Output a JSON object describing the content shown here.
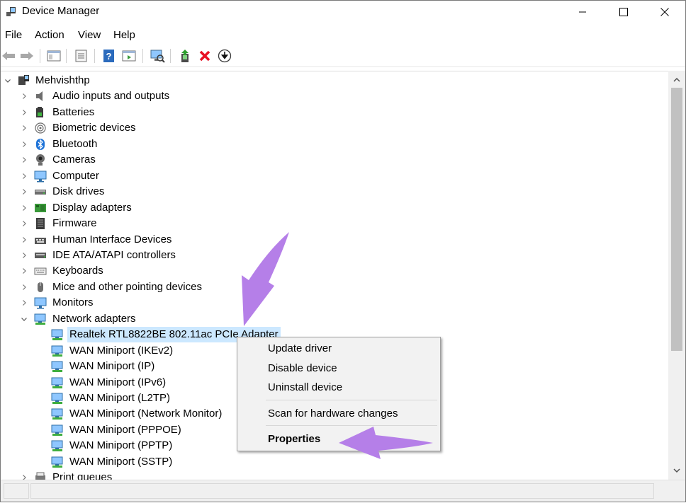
{
  "window": {
    "title": "Device Manager",
    "controls": {
      "minimize": "minimize",
      "maximize": "maximize",
      "close": "close"
    }
  },
  "menu": [
    "File",
    "Action",
    "View",
    "Help"
  ],
  "toolbar": {
    "buttons": [
      "back-icon",
      "forward-icon",
      "console-tree-icon",
      "properties-icon",
      "help-icon",
      "action-pane-icon",
      "scan-hardware-icon",
      "update-driver-icon",
      "uninstall-icon",
      "download-icon"
    ],
    "accent_red": "#e81123"
  },
  "tree": {
    "root": "Mehvishthp",
    "categories": [
      "Audio inputs and outputs",
      "Batteries",
      "Biometric devices",
      "Bluetooth",
      "Cameras",
      "Computer",
      "Disk drives",
      "Display adapters",
      "Firmware",
      "Human Interface Devices",
      "IDE ATA/ATAPI controllers",
      "Keyboards",
      "Mice and other pointing devices",
      "Monitors",
      "Network adapters"
    ],
    "network_adapters": [
      "Realtek RTL8822BE 802.11ac PCIe Adapter",
      "WAN Miniport (IKEv2)",
      "WAN Miniport (IP)",
      "WAN Miniport (IPv6)",
      "WAN Miniport (L2TP)",
      "WAN Miniport (Network Monitor)",
      "WAN Miniport (PPPOE)",
      "WAN Miniport (PPTP)",
      "WAN Miniport (SSTP)"
    ],
    "next_category": "Print queues",
    "selected": "Realtek RTL8822BE 802.11ac PCIe Adapter",
    "selection_color": "#cce8ff"
  },
  "context_menu": {
    "items": [
      "Update driver",
      "Disable device",
      "Uninstall device"
    ],
    "scan": "Scan for hardware changes",
    "properties": "Properties"
  },
  "annotations": {
    "arrow_color": "#b57fe8"
  }
}
